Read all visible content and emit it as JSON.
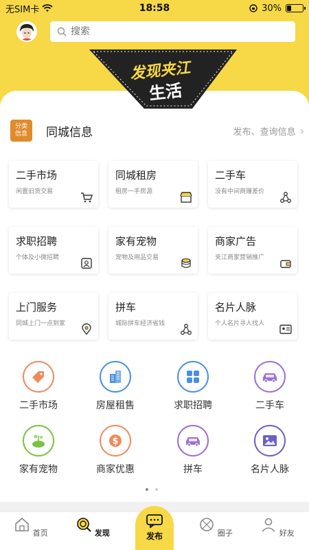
{
  "status": {
    "carrier": "无SIM卡",
    "time": "18:58",
    "battery": "30%",
    "battery_level": 0.3
  },
  "search": {
    "placeholder": "搜索"
  },
  "banner": {
    "line1": "发现夹江",
    "line2": "生活"
  },
  "info": {
    "logo": "分类信息",
    "title": "同城信息",
    "link": "发布、查询信息"
  },
  "categories": [
    {
      "title": "二手市场",
      "sub": "闲置旧货交易",
      "icon": "cart-icon"
    },
    {
      "title": "同城租房",
      "sub": "租房一手房源",
      "icon": "shop-icon"
    },
    {
      "title": "二手车",
      "sub": "没有中间商赚差价",
      "icon": "nodes-icon"
    },
    {
      "title": "求职招聘",
      "sub": "个体及小微招聘",
      "icon": "id-card-icon"
    },
    {
      "title": "家有宠物",
      "sub": "宠物及用品交易",
      "icon": "coins-icon"
    },
    {
      "title": "商家广告",
      "sub": "夹江商家营销推广",
      "icon": "wallet-icon"
    },
    {
      "title": "上门服务",
      "sub": "同城上门一点到家",
      "icon": "location-icon"
    },
    {
      "title": "拼车",
      "sub": "城际拼车经济省钱",
      "icon": "nodes-icon"
    },
    {
      "title": "名片人脉",
      "sub": "个人名片寻人找人",
      "icon": "card-icon"
    }
  ],
  "shortcuts": [
    {
      "label": "二手市场",
      "color": "#f08a5d",
      "icon": "tag-icon"
    },
    {
      "label": "房屋租售",
      "color": "#4a90e2",
      "icon": "building-icon"
    },
    {
      "label": "求职招聘",
      "color": "#4a90e2",
      "icon": "grid-icon"
    },
    {
      "label": "二手车",
      "color": "#9b6fd6",
      "icon": "car-icon"
    },
    {
      "label": "家有宠物",
      "color": "#7bc242",
      "icon": "plant-icon"
    },
    {
      "label": "商家优惠",
      "color": "#f08a5d",
      "icon": "dollar-icon"
    },
    {
      "label": "拼车",
      "color": "#9b6fd6",
      "icon": "car-icon"
    },
    {
      "label": "名片人脉",
      "color": "#6b5fc9",
      "icon": "picture-icon"
    }
  ],
  "tabs": [
    {
      "label": "首页",
      "icon": "home-icon"
    },
    {
      "label": "发现",
      "icon": "discover-icon"
    },
    {
      "label": "发布",
      "icon": "chat-icon"
    },
    {
      "label": "圈子",
      "icon": "circle-icon"
    },
    {
      "label": "好友",
      "icon": "friends-icon"
    }
  ]
}
